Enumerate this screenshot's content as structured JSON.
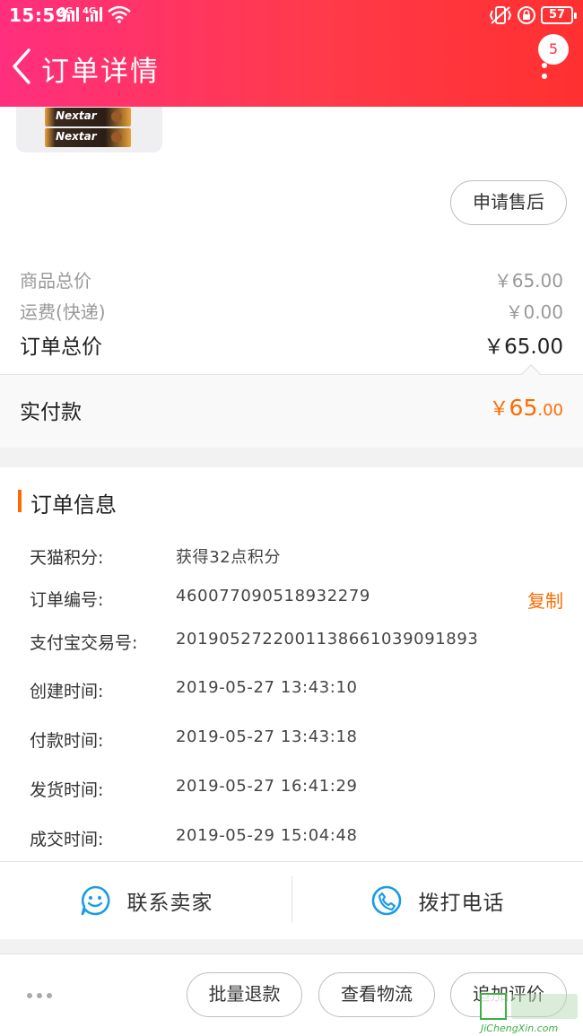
{
  "status_bar": {
    "time": "15:59",
    "signal_1": "2G",
    "signal_2": "4G",
    "battery": "57"
  },
  "header": {
    "title": "订单详情",
    "badge_count": "5"
  },
  "product": {
    "brand": "Nextar"
  },
  "after_sale_label": "申请售后",
  "prices": {
    "goods_total_label": "商品总价",
    "goods_total_value": "￥65.00",
    "shipping_label": "运费(快递)",
    "shipping_value": "￥0.00",
    "order_total_label": "订单总价",
    "order_total_value": "￥65.00",
    "paid_label": "实付款",
    "paid_currency": "￥",
    "paid_int": "65",
    "paid_dec": ".00"
  },
  "order_info": {
    "section_title": "订单信息",
    "rows": [
      {
        "key": "天猫积分:",
        "value": "获得32点积分"
      },
      {
        "key": "订单编号:",
        "value": "460077090518932279"
      },
      {
        "key": "支付宝交易号:",
        "value": "2019052722001138661039091893"
      },
      {
        "key": "创建时间:",
        "value": "2019-05-27  13:43:10"
      },
      {
        "key": "付款时间:",
        "value": "2019-05-27  13:43:18"
      },
      {
        "key": "发货时间:",
        "value": "2019-05-27  16:41:29"
      },
      {
        "key": "成交时间:",
        "value": "2019-05-29  15:04:48"
      }
    ],
    "copy_label": "复制"
  },
  "contact": {
    "seller_label": "联系卖家",
    "phone_label": "拨打电话"
  },
  "actions": {
    "batch_refund": "批量退款",
    "view_logistics": "查看物流",
    "add_review": "追加评价"
  },
  "watermark": {
    "text": "JiChengXin.com"
  },
  "colors": {
    "header_start": "#ff2f7e",
    "header_end": "#ff3030",
    "accent_orange": "#ff6a00",
    "contact_blue": "#1a9be8"
  }
}
